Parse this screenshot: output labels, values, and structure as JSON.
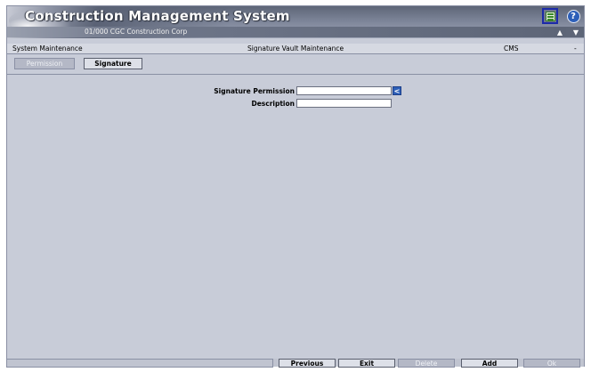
{
  "header": {
    "app_title": "Construction Management System",
    "company": "01/000  CGC Construction Corp",
    "help_glyph": "?",
    "icons": [
      "grid-icon",
      "help-icon",
      "arrow-up-icon",
      "arrow-down-icon"
    ]
  },
  "title_strip": {
    "module": "System Maintenance",
    "screen_title": "Signature Vault Maintenance",
    "system_code": "CMS",
    "minimize": "-"
  },
  "tabs": [
    {
      "label": "Permission",
      "enabled": false
    },
    {
      "label": "Signature",
      "enabled": true
    }
  ],
  "form": {
    "signature_permission_label": "Signature Permission",
    "signature_permission_value": "",
    "description_label": "Description",
    "description_value": "",
    "lookup_glyph": "<"
  },
  "buttons": {
    "previous": "Previous",
    "exit": "Exit",
    "delete": "Delete",
    "add": "Add",
    "ok": "Ok"
  },
  "colors": {
    "background": "#c8ccd8",
    "accent_blue": "#2d5fb8",
    "focus_border": "#1c2aa8"
  }
}
